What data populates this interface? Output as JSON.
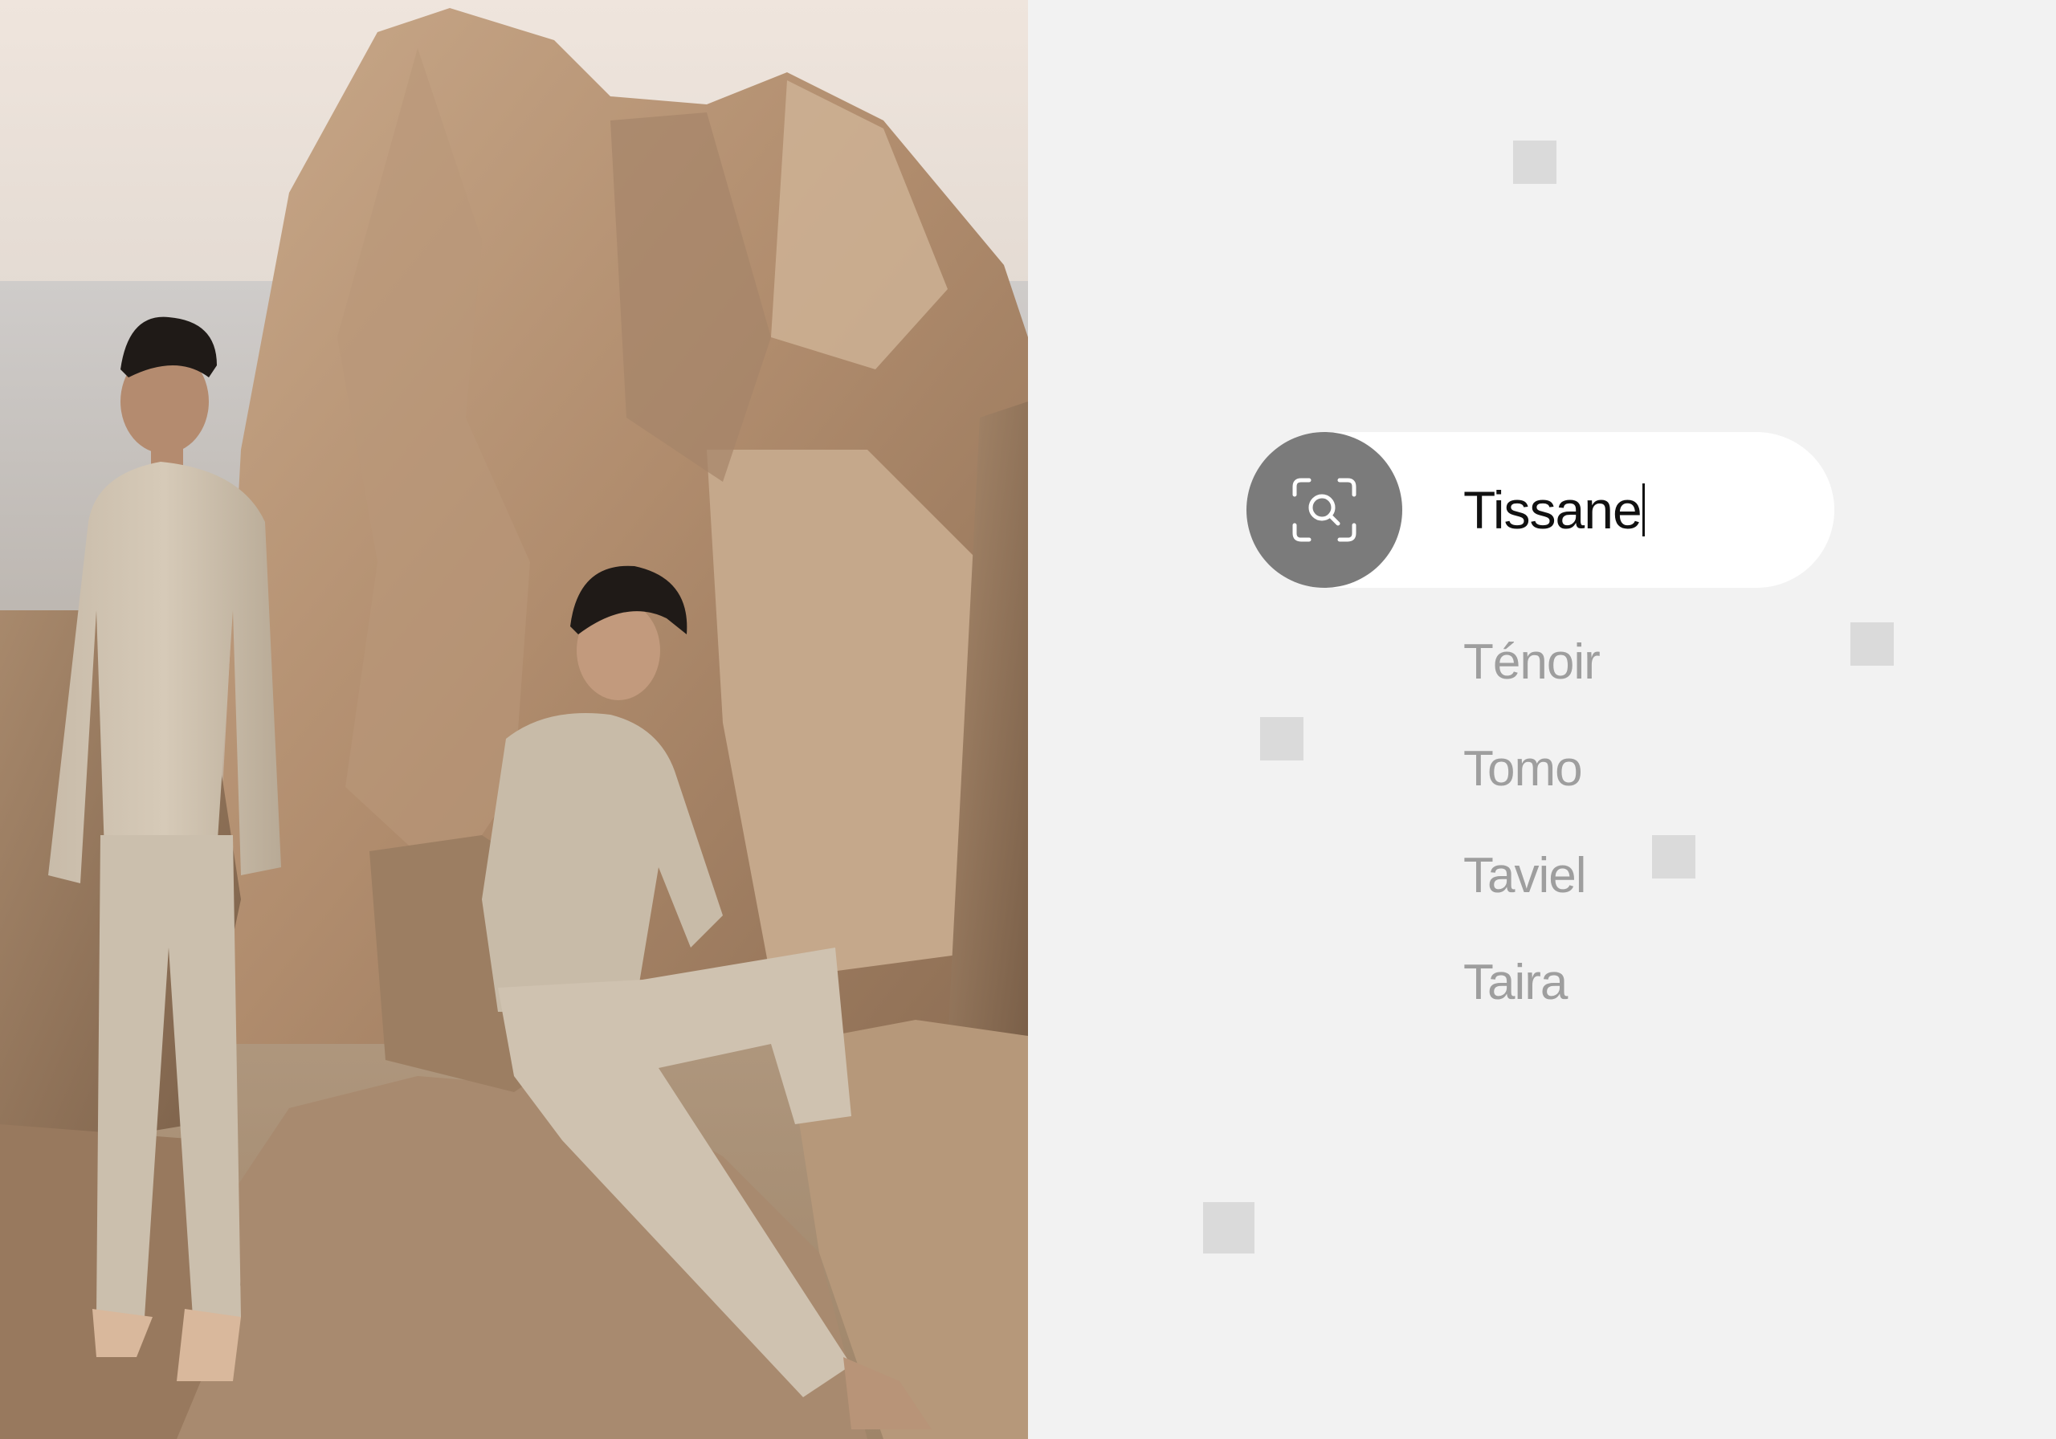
{
  "photo": {
    "description_icon": "photo-icon"
  },
  "search": {
    "button_icon": "scan-search-icon",
    "value": "Tissane"
  },
  "suggestions": [
    {
      "label": "Ténoir"
    },
    {
      "label": "Tomo"
    },
    {
      "label": "Taviel"
    },
    {
      "label": "Taira"
    }
  ],
  "colors": {
    "background": "#f2f2f2",
    "search_field": "#ffffff",
    "search_button": "#7b7b7b",
    "suggestion_text": "#9e9e9e",
    "input_text": "#111111",
    "decorative_square": "#dadada"
  }
}
